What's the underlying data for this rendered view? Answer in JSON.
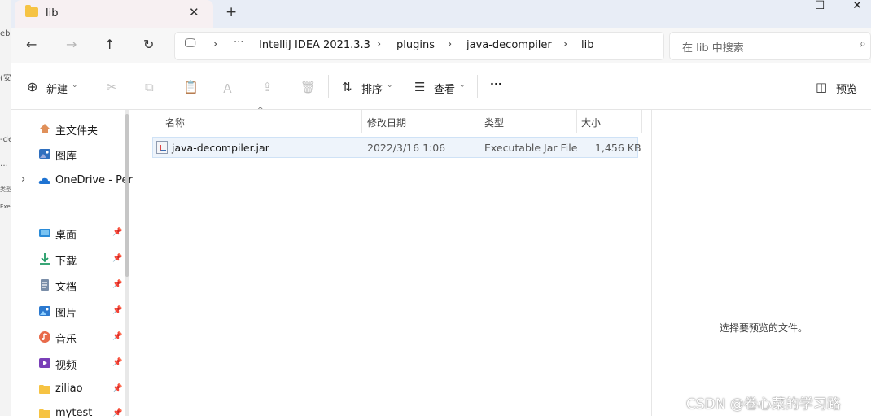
{
  "window": {
    "tab_title": "lib",
    "tab_close_glyph": "✕",
    "new_tab_glyph": "+",
    "controls": {
      "minimize": "—",
      "maximize": "☐",
      "close": "✕"
    }
  },
  "background_window_fragments": [
    "eb",
    "(安",
    "-de",
    "…",
    "类型",
    "Exec"
  ],
  "navigation": {
    "back_glyph": "←",
    "forward_glyph": "→",
    "up_glyph": "↑",
    "refresh_glyph": "↻",
    "pc_glyph": "🖵",
    "more_glyph": "···",
    "breadcrumb": [
      "IntelliJ IDEA 2021.3.3",
      "plugins",
      "java-decompiler",
      "lib"
    ],
    "chevron": "›"
  },
  "search": {
    "placeholder": "在 lib 中搜索",
    "icon": "search-icon"
  },
  "toolbar": {
    "new_label": "新建",
    "new_glyph": "⊕",
    "caret": "⌄",
    "sort_label": "排序",
    "sort_glyph": "⇅",
    "view_label": "查看",
    "view_glyph": "☰",
    "more_glyph": "···",
    "preview_label": "预览",
    "preview_glyph": "◫",
    "icons": {
      "cut": "✂",
      "copy": "⧉",
      "paste": "📋",
      "rename": "Ａ",
      "share": "⇪",
      "delete": "🗑"
    }
  },
  "sidebar": {
    "items": [
      {
        "label": "主文件夹",
        "icon": "home-icon",
        "pinned": false
      },
      {
        "label": "图库",
        "icon": "gallery-icon",
        "pinned": false
      },
      {
        "label": "OneDrive - Per",
        "icon": "cloud-icon",
        "pinned": false,
        "expand_glyph": "›"
      },
      {
        "label": "桌面",
        "icon": "desktop-icon",
        "pinned": true
      },
      {
        "label": "下载",
        "icon": "download-icon",
        "pinned": true
      },
      {
        "label": "文档",
        "icon": "document-icon",
        "pinned": true
      },
      {
        "label": "图片",
        "icon": "pictures-icon",
        "pinned": true
      },
      {
        "label": "音乐",
        "icon": "music-icon",
        "pinned": true
      },
      {
        "label": "视频",
        "icon": "video-icon",
        "pinned": true
      },
      {
        "label": "ziliao",
        "icon": "folder-icon",
        "pinned": true
      },
      {
        "label": "mytest",
        "icon": "folder-icon",
        "pinned": true
      }
    ],
    "pin_glyph": "📌"
  },
  "file_list": {
    "columns": [
      "名称",
      "修改日期",
      "类型",
      "大小"
    ],
    "sort_caret": "^",
    "rows": [
      {
        "name": "java-decompiler.jar",
        "modified": "2022/3/16 1:06",
        "type": "Executable Jar File",
        "size": "1,456 KB"
      }
    ]
  },
  "preview_pane": {
    "empty_text": "选择要预览的文件。"
  },
  "watermark": "CSDN @卷心菜的学习路",
  "colors": {
    "titlebar": "#e8edf6",
    "tab": "#f7f0f2",
    "folder": "#f6c343",
    "selection": "#eef4fb"
  }
}
